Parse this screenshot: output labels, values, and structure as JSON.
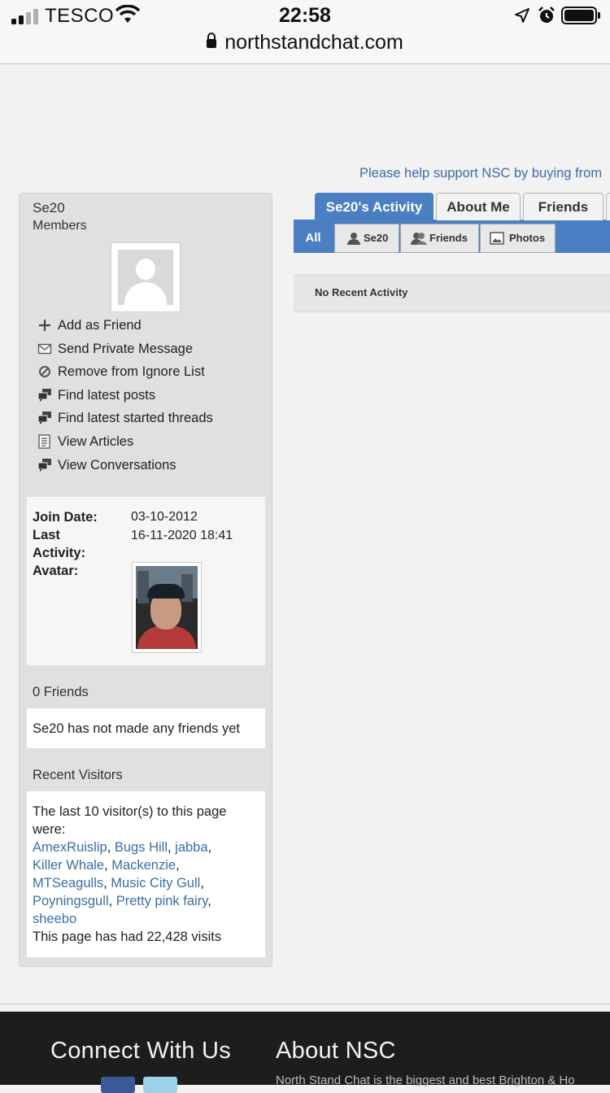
{
  "status_bar": {
    "carrier": "TESCO",
    "time": "22:58"
  },
  "browser": {
    "url": "northstandchat.com"
  },
  "support_text": "Please help support NSC by buying from",
  "profile": {
    "username": "Se20",
    "usergroup": "Members",
    "actions": [
      {
        "label": "Add as Friend",
        "icon": "plus-icon"
      },
      {
        "label": "Send Private Message",
        "icon": "envelope-icon"
      },
      {
        "label": "Remove from Ignore List",
        "icon": "ban-icon"
      },
      {
        "label": "Find latest posts",
        "icon": "forum-posts-icon"
      },
      {
        "label": "Find latest started threads",
        "icon": "forum-threads-icon"
      },
      {
        "label": "View Articles",
        "icon": "article-icon"
      },
      {
        "label": "View Conversations",
        "icon": "conversations-icon"
      }
    ],
    "info": {
      "join_date_label": "Join Date:",
      "join_date": "03-10-2012",
      "last_activity_label_1": "Last",
      "last_activity_label_2": "Activity:",
      "last_activity": "16-11-2020 18:41",
      "avatar_label": "Avatar:"
    },
    "friends": {
      "title": "0 Friends",
      "empty_text": "Se20 has not made any friends yet"
    },
    "visitors": {
      "title": "Recent Visitors",
      "intro": "The last 10 visitor(s) to this page were:",
      "names": [
        "AmexRuislip",
        "Bugs Hill",
        "jabba",
        "Killer Whale",
        "Mackenzie",
        "MTSeagulls",
        "Music City Gull",
        "Poyningsgull",
        "Pretty pink fairy",
        "sheebo"
      ],
      "visits_text": "This page has had 22,428 visits"
    }
  },
  "tabs": [
    {
      "label": "Se20's Activity",
      "active": true
    },
    {
      "label": "About Me",
      "active": false
    },
    {
      "label": "Friends",
      "active": false
    }
  ],
  "subtabs": [
    {
      "label": "All",
      "active": true
    },
    {
      "label": "Se20",
      "icon": "user-icon"
    },
    {
      "label": "Friends",
      "icon": "users-icon"
    },
    {
      "label": "Photos",
      "icon": "photo-icon"
    }
  ],
  "activity": {
    "empty_text": "No Recent Activity"
  },
  "footer": {
    "connect_title": "Connect With Us",
    "about_title": "About NSC",
    "about_text": "North Stand Chat is the biggest and best Brighton & Ho"
  },
  "colors": {
    "accent": "#4a7fc1",
    "link": "#3a6ea5",
    "footer": "#1d1d1d"
  }
}
